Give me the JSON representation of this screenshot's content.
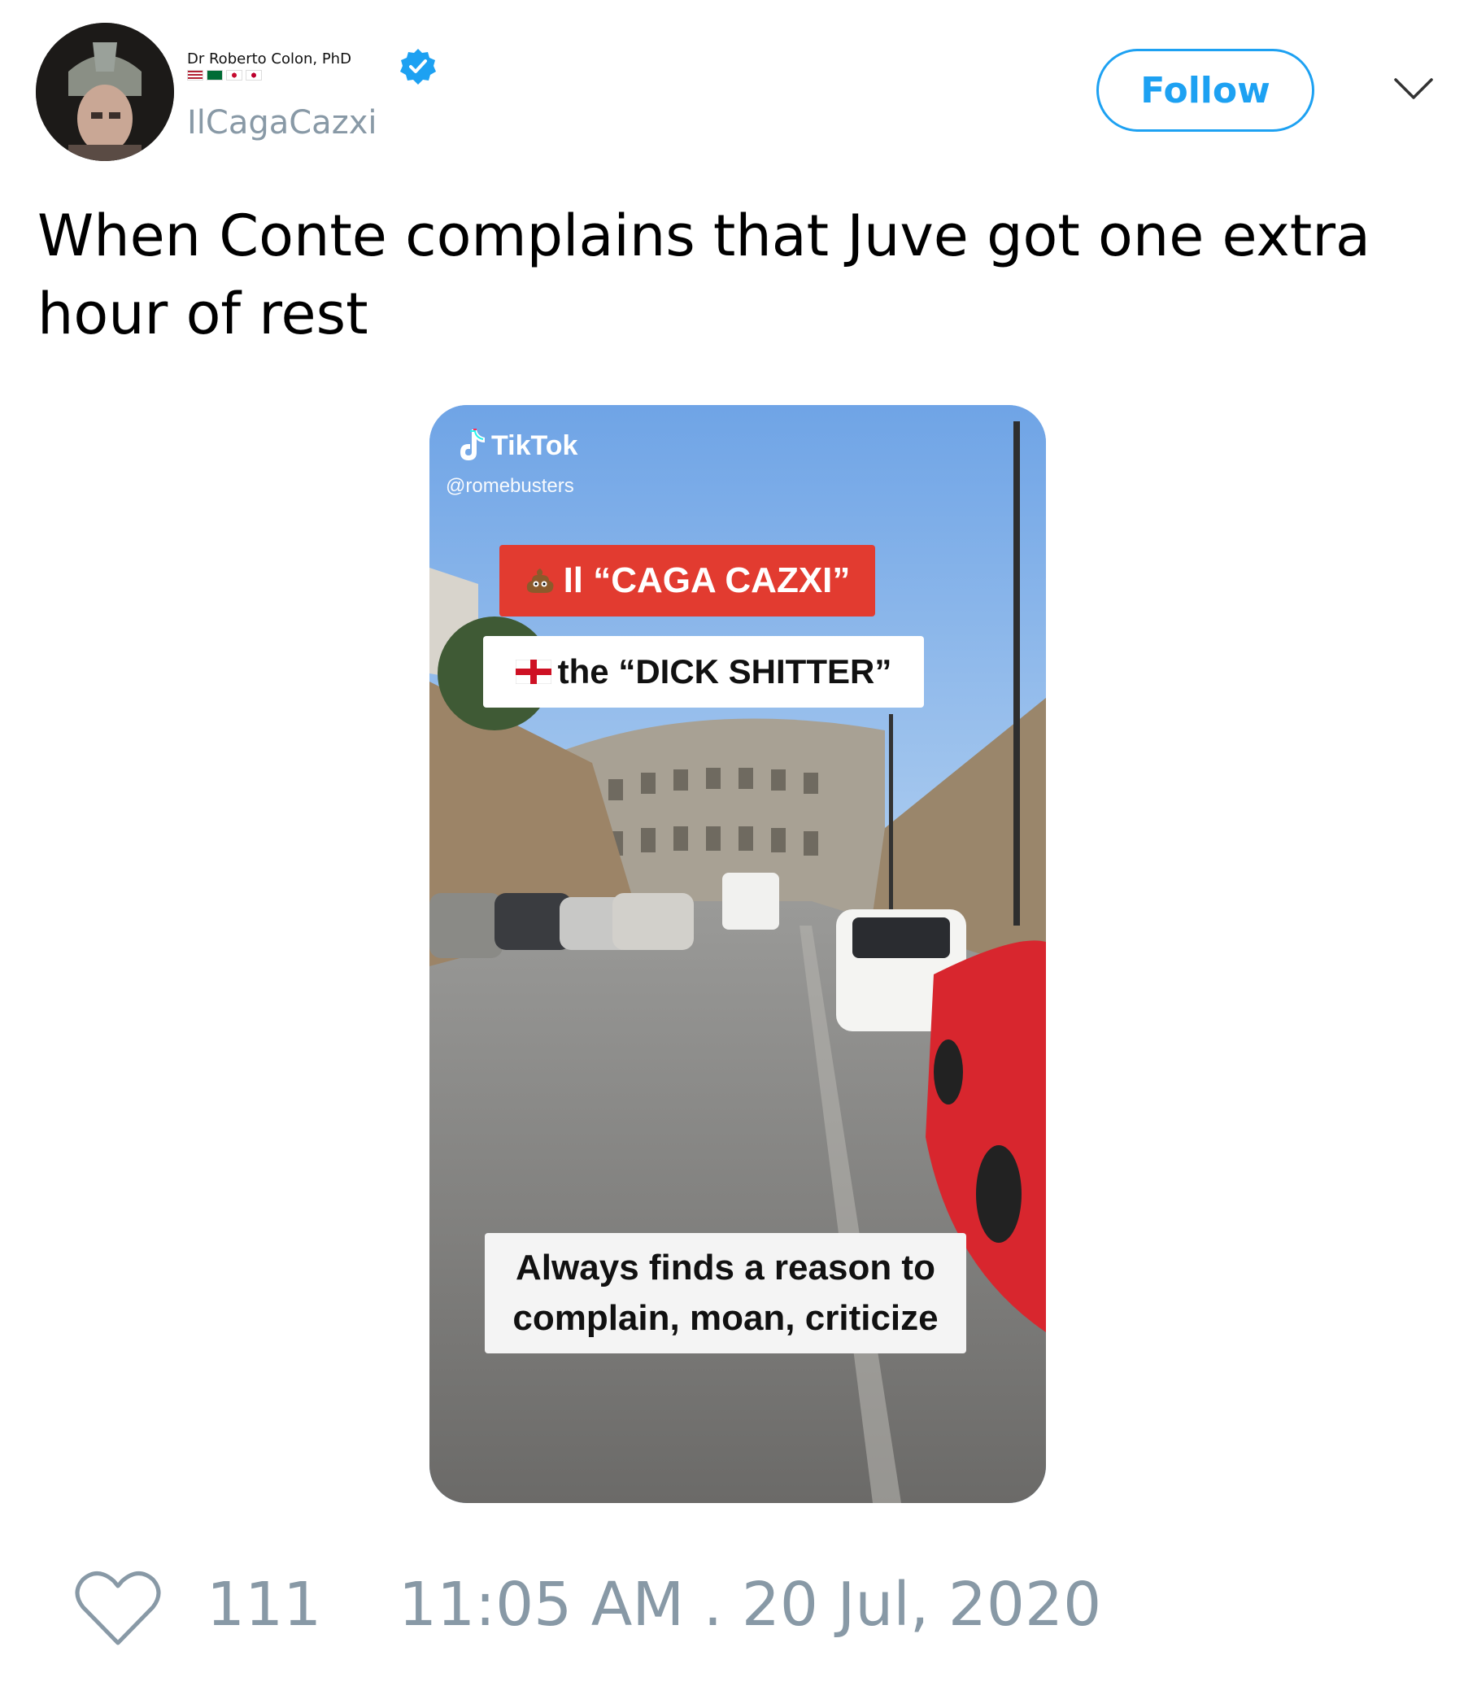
{
  "author": {
    "name": "Dr Roberto Colon, PhD",
    "handle": "IlCagaCazxi",
    "verified": true
  },
  "follow_button": {
    "label": "Follow"
  },
  "tweet": {
    "text": "When Conte complains that Juve got one extra hour of rest"
  },
  "media": {
    "watermark": "TikTok",
    "source_user": "@romebusters",
    "caption_red": "Il “CAGA CAZXI”",
    "caption_white": "the “DICK SHITTER”",
    "caption_bottom_line1": "Always finds a reason to",
    "caption_bottom_line2": "complain, moan, criticize"
  },
  "footer": {
    "likes": "111",
    "timestamp": "11:05 AM . 20 Jul, 2020"
  },
  "colors": {
    "accent": "#1da1f2",
    "muted": "#8899a6",
    "caption_red": "#e23b30"
  },
  "icons": [
    "verified-badge-icon",
    "chevron-down-icon",
    "heart-icon",
    "tiktok-logo-icon",
    "poop-emoji-icon",
    "england-flag-icon"
  ]
}
